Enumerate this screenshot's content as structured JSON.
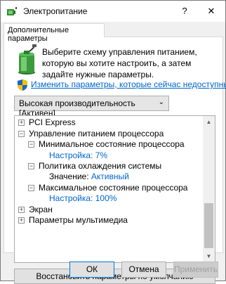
{
  "window": {
    "title": "Электропитание",
    "help_label": "?",
    "close_label": "✕",
    "app_icon": "power-options-icon"
  },
  "tab": {
    "label": "Дополнительные параметры"
  },
  "description": "Выберите схему управления питанием, которую вы хотите настроить, а затем задайте нужные параметры.",
  "link": {
    "label": "Изменить параметры, которые сейчас недоступны",
    "icon": "uac-shield-icon"
  },
  "scheme_select": {
    "value": "Высокая производительность [Активен]",
    "chevron": "⌄"
  },
  "tree": {
    "items": [
      {
        "expander": "+",
        "label": "PCI Express"
      },
      {
        "expander": "−",
        "label": "Управление питанием процессора"
      },
      {
        "expander": "−",
        "label": "Минимальное состояние процессора"
      },
      {
        "prefix": "",
        "label": "Настройка: 7%"
      },
      {
        "expander": "−",
        "label": "Политика охлаждения системы"
      },
      {
        "prefix": "Значение:",
        "label": "Активный"
      },
      {
        "expander": "−",
        "label": "Максимальное состояние процессора"
      },
      {
        "prefix": "",
        "label": "Настройка: 100%"
      },
      {
        "expander": "+",
        "label": "Экран"
      },
      {
        "expander": "+",
        "label": "Параметры мультимедиа"
      }
    ],
    "scroll_up": "▲",
    "scroll_down": "▼"
  },
  "buttons": {
    "restore": "Восстановить параметры по умолчанию",
    "ok": "ОК",
    "cancel": "Отмена",
    "apply": "Применить"
  },
  "colors": {
    "link": "#0066cc",
    "value": "#0066cc",
    "accent": "#0078d7"
  }
}
